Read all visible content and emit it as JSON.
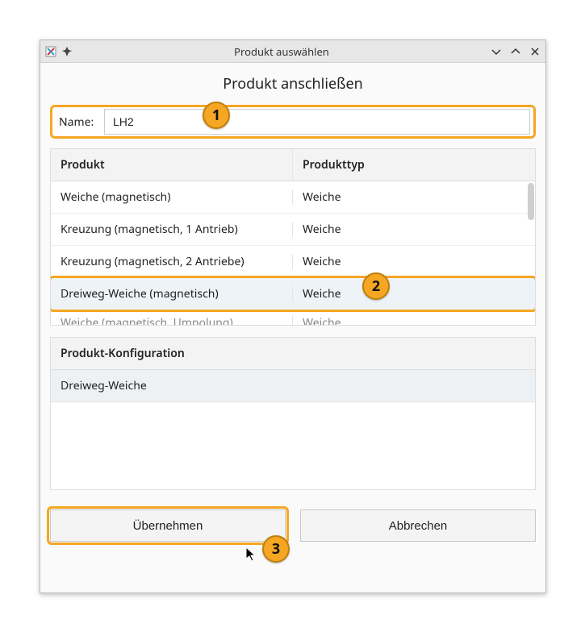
{
  "window": {
    "title": "Produkt auswählen"
  },
  "heading": "Produkt anschließen",
  "nameField": {
    "label": "Name:",
    "value": "LH2"
  },
  "productTable": {
    "headers": {
      "product": "Produkt",
      "type": "Produkttyp"
    },
    "rows": [
      {
        "product": "Weiche (magnetisch)",
        "type": "Weiche"
      },
      {
        "product": "Kreuzung (magnetisch, 1 Antrieb)",
        "type": "Weiche"
      },
      {
        "product": "Kreuzung (magnetisch, 2 Antriebe)",
        "type": "Weiche"
      },
      {
        "product": "Dreiweg-Weiche (magnetisch)",
        "type": "Weiche"
      }
    ],
    "partialRow": {
      "product": "Weiche (magnetisch, Umpolung)",
      "type": "Weiche"
    },
    "selectedIndex": 3
  },
  "config": {
    "header": "Produkt-Konfiguration",
    "value": "Dreiweg-Weiche"
  },
  "buttons": {
    "apply": "Übernehmen",
    "cancel": "Abbrechen"
  },
  "callouts": {
    "c1": "1",
    "c2": "2",
    "c3": "3"
  }
}
